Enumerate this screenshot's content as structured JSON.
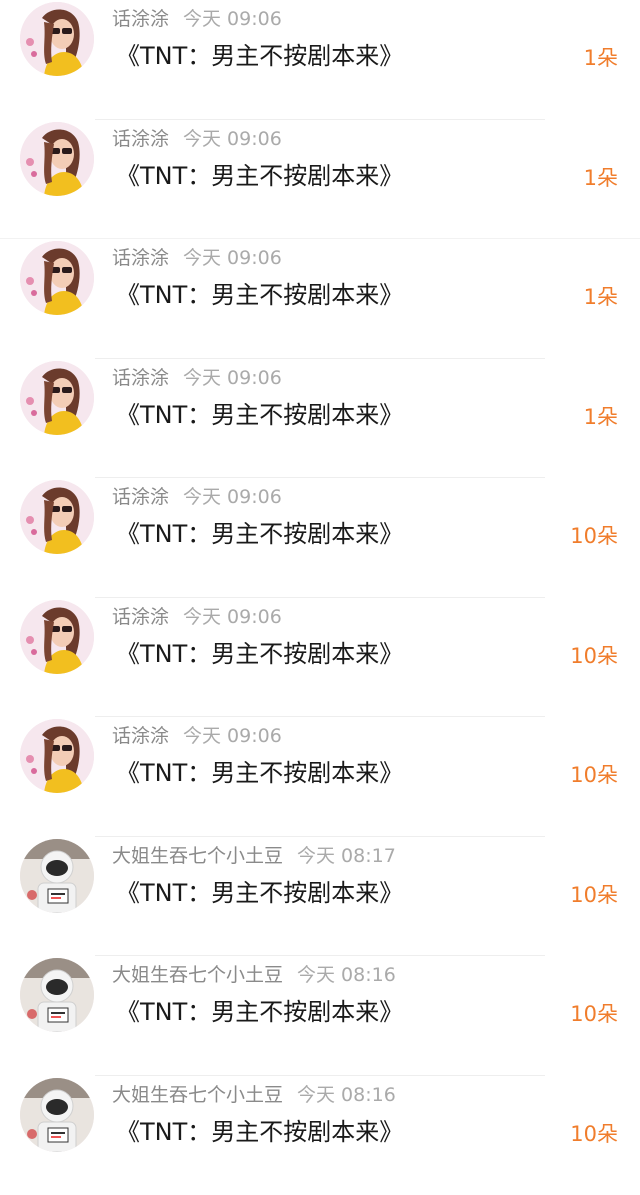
{
  "rows": [
    {
      "user": "话涂涂",
      "time": "今天 09:06",
      "title": "《TNT：男主不按剧本来》",
      "amount": "1朵",
      "avatar": "girl-sunglasses-avatar"
    },
    {
      "user": "话涂涂",
      "time": "今天 09:06",
      "title": "《TNT：男主不按剧本来》",
      "amount": "1朵",
      "avatar": "girl-sunglasses-avatar"
    },
    {
      "user": "话涂涂",
      "time": "今天 09:06",
      "title": "《TNT：男主不按剧本来》",
      "amount": "1朵",
      "avatar": "girl-sunglasses-avatar"
    },
    {
      "user": "话涂涂",
      "time": "今天 09:06",
      "title": "《TNT：男主不按剧本来》",
      "amount": "1朵",
      "avatar": "girl-sunglasses-avatar"
    },
    {
      "user": "话涂涂",
      "time": "今天 09:06",
      "title": "《TNT：男主不按剧本来》",
      "amount": "10朵",
      "avatar": "girl-sunglasses-avatar"
    },
    {
      "user": "话涂涂",
      "time": "今天 09:06",
      "title": "《TNT：男主不按剧本来》",
      "amount": "10朵",
      "avatar": "girl-sunglasses-avatar"
    },
    {
      "user": "话涂涂",
      "time": "今天 09:06",
      "title": "《TNT：男主不按剧本来》",
      "amount": "10朵",
      "avatar": "girl-sunglasses-avatar"
    },
    {
      "user": "大姐生吞七个小土豆",
      "time": "今天 08:17",
      "title": "《TNT：男主不按剧本来》",
      "amount": "10朵",
      "avatar": "astronaut-avatar"
    },
    {
      "user": "大姐生吞七个小土豆",
      "time": "今天 08:16",
      "title": "《TNT：男主不按剧本来》",
      "amount": "10朵",
      "avatar": "astronaut-avatar"
    },
    {
      "user": "大姐生吞七个小土豆",
      "time": "今天 08:16",
      "title": "《TNT：男主不按剧本来》",
      "amount": "10朵",
      "avatar": "astronaut-avatar"
    }
  ],
  "colors": {
    "amount": "#f07d2c",
    "username": "#8a8a8a",
    "time": "#aaaaaa",
    "title": "#1a1a1a",
    "divider": "#eeeeee"
  }
}
